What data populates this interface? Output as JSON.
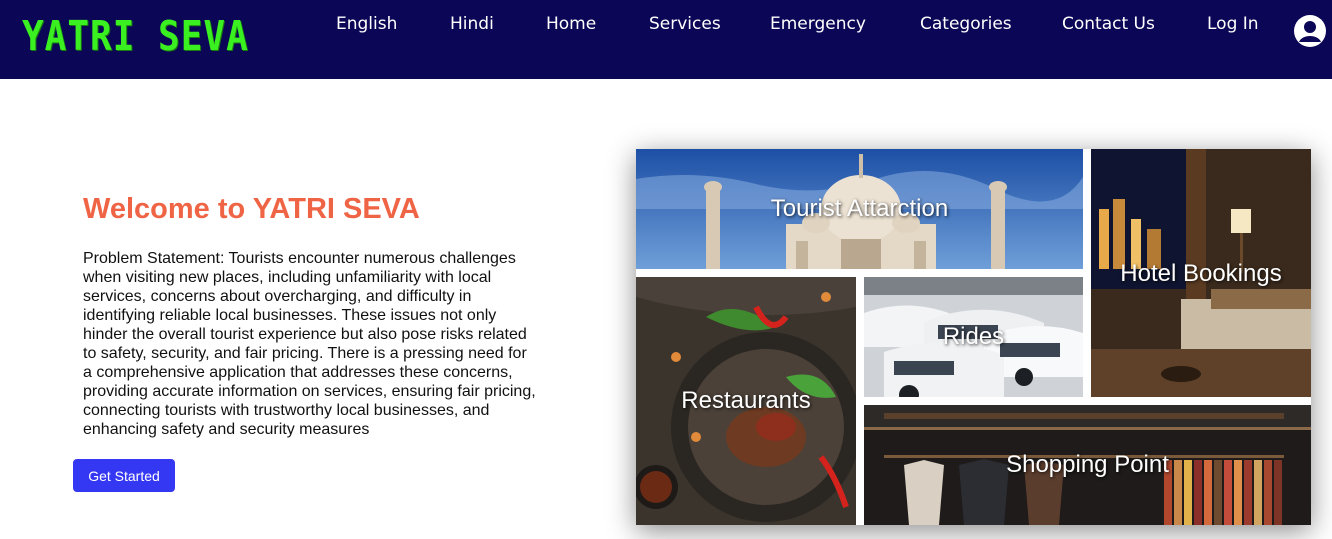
{
  "brand": {
    "logo_text": "YATRI SEVA",
    "logo_color": "#3bf021"
  },
  "nav": {
    "english": "English",
    "hindi": "Hindi",
    "home": "Home",
    "services": "Services",
    "emergency": "Emergency",
    "categories": "Categories",
    "contact": "Contact Us",
    "login": "Log In",
    "user_icon": "user-circle-icon",
    "bg_color": "#0b0756"
  },
  "hero": {
    "title": "Welcome to YATRI SEVA",
    "title_color": "#f06446",
    "description": "Problem Statement: Tourists encounter numerous challenges when visiting new places, including unfamiliarity with local services, concerns about overcharging, and difficulty in identifying reliable local businesses. These issues not only hinder the overall tourist experience but also pose risks related to safety, security, and fair pricing. There is a pressing need for a comprehensive application that addresses these concerns, providing accurate information on services, ensuring fair pricing, connecting tourists with trustworthy local businesses, and enhancing safety and security measures",
    "cta_label": "Get Started",
    "cta_color": "#3538f2"
  },
  "collage": {
    "tourist": "Tourist Attarction",
    "hotel": "Hotel Bookings",
    "rides": "Rides",
    "restaurants": "Restaurants",
    "shopping": "Shopping Point"
  }
}
